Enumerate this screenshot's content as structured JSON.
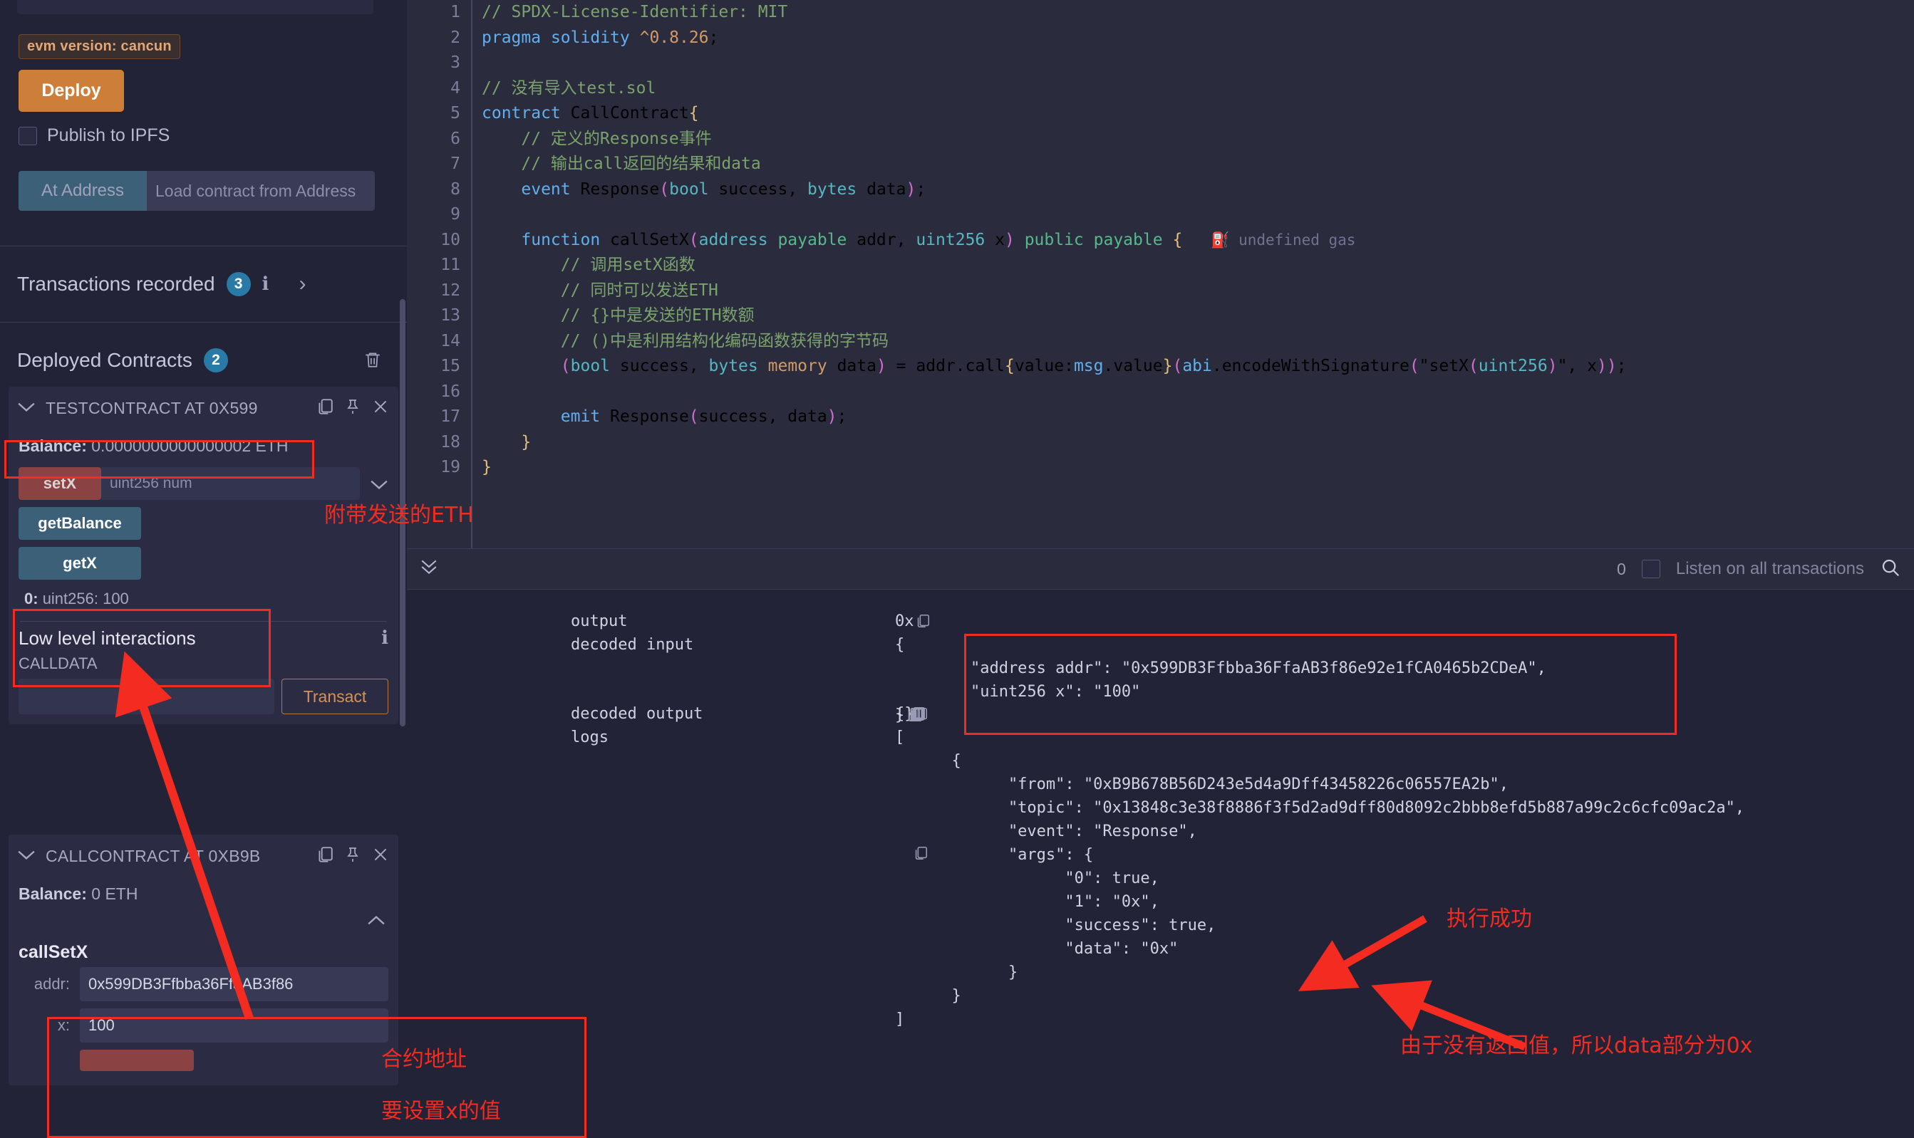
{
  "sidebar": {
    "evm_badge": "evm version: cancun",
    "deploy_label": "Deploy",
    "publish_ipfs_label": "Publish to IPFS",
    "at_address_label": "At Address",
    "at_address_placeholder": "Load contract from Address",
    "transactions_recorded_label": "Transactions recorded",
    "transactions_recorded_count": "3",
    "deployed_contracts_label": "Deployed Contracts",
    "deployed_contracts_count": "2",
    "contracts": [
      {
        "title": "TESTCONTRACT AT 0X599",
        "balance": "Balance: 0.0000000000000002 ETH",
        "balance_bold": "Balance:",
        "balance_value": "0.0000000000000002 ETH",
        "functions": [
          {
            "name": "setX",
            "kind": "write",
            "input_placeholder": "uint256 num"
          },
          {
            "name": "getBalance",
            "kind": "read"
          },
          {
            "name": "getX",
            "kind": "read",
            "result": "0: uint256: 100",
            "result_index": "0:",
            "result_value": "uint256: 100"
          }
        ],
        "low_level": {
          "title": "Low level interactions",
          "calldata_label": "CALLDATA",
          "calldata_value": "",
          "transact_label": "Transact"
        }
      },
      {
        "title": "CALLCONTRACT AT 0XB9B",
        "balance_bold": "Balance:",
        "balance_value": "0 ETH",
        "function_name": "callSetX",
        "params": [
          {
            "label": "addr:",
            "value": "0x599DB3Ffbba36FfaAB3f86"
          },
          {
            "label": "x:",
            "value": "100"
          }
        ]
      }
    ]
  },
  "editor": {
    "lines": [
      {
        "n": "1",
        "text": "// SPDX-License-Identifier: MIT"
      },
      {
        "n": "2",
        "text": "pragma solidity ^0.8.26;"
      },
      {
        "n": "3",
        "text": ""
      },
      {
        "n": "4",
        "text": "// 没有导入test.sol"
      },
      {
        "n": "5",
        "text": "contract CallContract{"
      },
      {
        "n": "6",
        "text": "    // 定义的Response事件"
      },
      {
        "n": "7",
        "text": "    // 输出call返回的结果和data"
      },
      {
        "n": "8",
        "text": "    event Response(bool success, bytes data);"
      },
      {
        "n": "9",
        "text": ""
      },
      {
        "n": "10",
        "text": "    function callSetX(address payable addr, uint256 x) public payable {"
      },
      {
        "n": "11",
        "text": "        // 调用setX函数"
      },
      {
        "n": "12",
        "text": "        // 同时可以发送ETH"
      },
      {
        "n": "13",
        "text": "        // {}中是发送的ETH数额"
      },
      {
        "n": "14",
        "text": "        // ()中是利用结构化编码函数获得的字节码"
      },
      {
        "n": "15",
        "text": "        (bool success, bytes memory data) = addr.call{value:msg.value}(abi.encodeWithSignature(\"setX(uint256)\", x));"
      },
      {
        "n": "16",
        "text": ""
      },
      {
        "n": "17",
        "text": "        emit Response(success, data);"
      },
      {
        "n": "18",
        "text": "    }"
      },
      {
        "n": "19",
        "text": "}"
      }
    ],
    "gas_hint": "undefined gas"
  },
  "terminal": {
    "count": "0",
    "listen_label": "Listen on all transactions",
    "rows": [
      {
        "label": "output",
        "value": "0x"
      },
      {
        "label": "decoded input",
        "value": ""
      },
      {
        "label": "decoded output",
        "value": "{}"
      },
      {
        "label": "logs",
        "value": ""
      }
    ],
    "decoded_input_lines": [
      "{",
      "        \"address addr\": \"0x599DB3Ffbba36FfaAB3f86e92e1fCA0465b2CDeA\",",
      "        \"uint256 x\": \"100\"",
      "}"
    ],
    "logs_lines": [
      "[",
      "      {",
      "            \"from\": \"0xB9B678B56D243e5d4a9Dff43458226c06557EA2b\",",
      "            \"topic\": \"0x13848c3e38f8886f3f5d2ad9dff80d8092c2bbb8efd5b887a99c2c6cfc09ac2a\",",
      "            \"event\": \"Response\",",
      "            \"args\": {",
      "                  \"0\": true,",
      "                  \"1\": \"0x\",",
      "                  \"success\": true,",
      "                  \"data\": \"0x\"",
      "            }",
      "      }",
      "]"
    ]
  },
  "annotations": {
    "eth_sent": "附带发送的ETH",
    "contract_address": "合约地址",
    "set_x_value": "要设置x的值",
    "exec_success": "执行成功",
    "no_return_value": "由于没有返回值，所以data部分为0x"
  },
  "colors": {
    "accent_orange": "#cd7f3a",
    "accent_blue": "#3d6079",
    "accent_red": "#8a4242",
    "badge_blue": "#2a7aa8",
    "annotation_red": "#f42b20",
    "bg": "#222336",
    "editor_bg": "#2a2b3d"
  }
}
